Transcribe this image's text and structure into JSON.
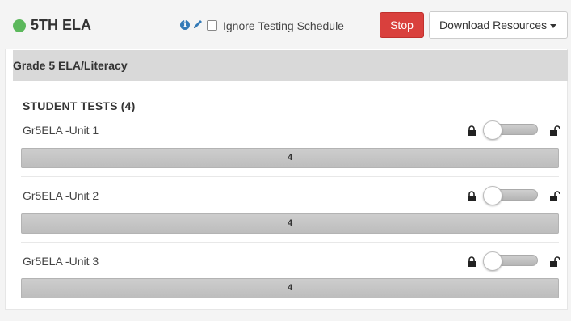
{
  "header": {
    "class_name": "5TH ELA",
    "status_color": "#5cb85c",
    "info_icon": "info-circle-icon",
    "edit_icon": "pencil-icon",
    "ignore_schedule_label": "Ignore Testing Schedule",
    "ignore_schedule_checked": false,
    "stop_label": "Stop",
    "download_label": "Download Resources"
  },
  "panel": {
    "heading": "Grade 5 ELA/Literacy",
    "tests_header": "STUDENT TESTS (4)",
    "tests": [
      {
        "name": "Gr5ELA -Unit 1",
        "count": "4",
        "locked": true
      },
      {
        "name": "Gr5ELA -Unit 2",
        "count": "4",
        "locked": true
      },
      {
        "name": "Gr5ELA -Unit 3",
        "count": "4",
        "locked": true
      }
    ]
  }
}
